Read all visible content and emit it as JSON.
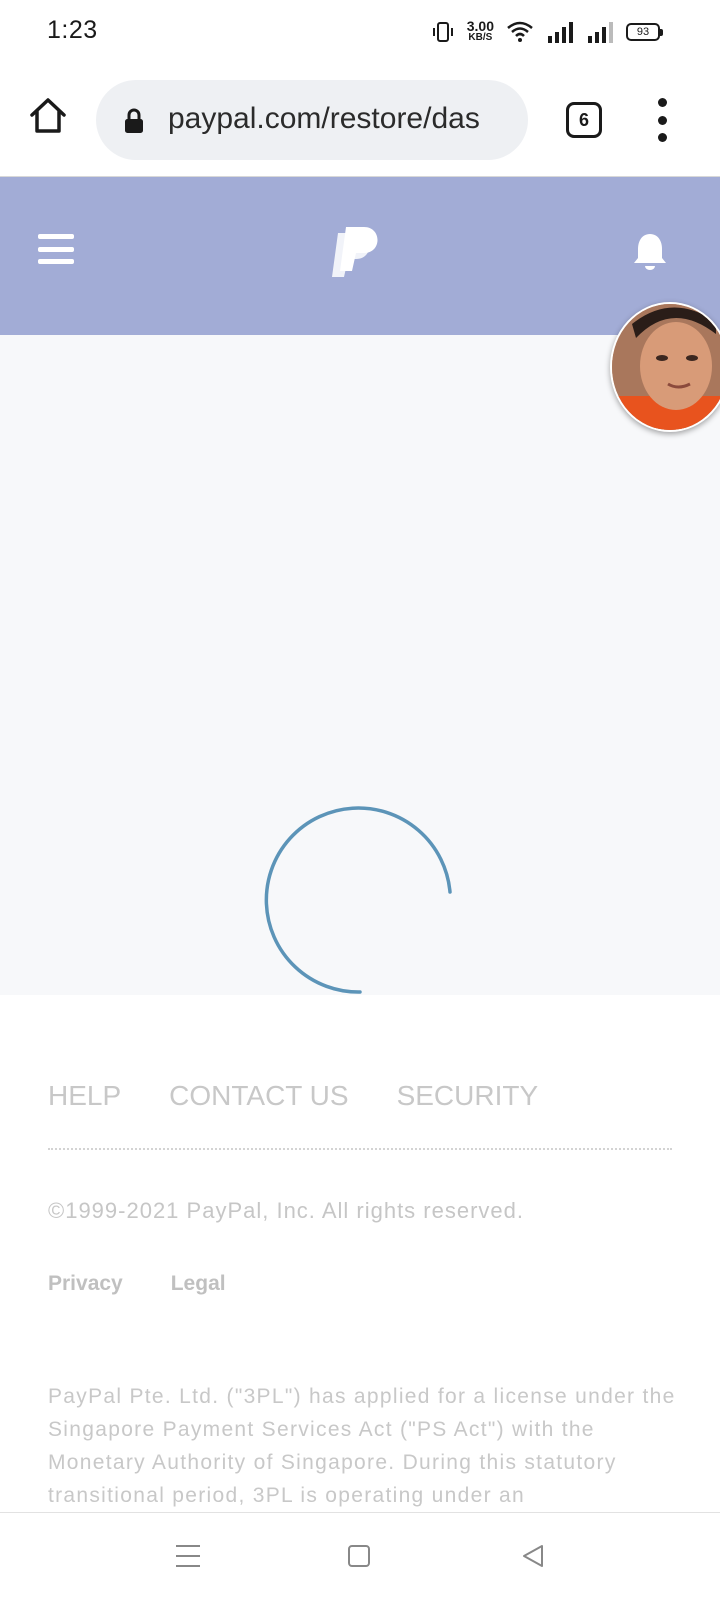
{
  "status_bar": {
    "time": "1:23",
    "net_speed_value": "3.00",
    "net_speed_unit": "KB/S",
    "battery": "93"
  },
  "browser": {
    "url": "paypal.com/restore/das",
    "tab_count": "6"
  },
  "header": {
    "bg_color": "#a2acd6",
    "menu_icon": "hamburger-menu-icon",
    "logo": "paypal-logo",
    "bell_icon": "bell-icon"
  },
  "loading": {
    "spinner_color": "#5c94b8"
  },
  "footer": {
    "links": [
      "HELP",
      "CONTACT US",
      "SECURITY"
    ],
    "copyright": "©1999-2021 PayPal, Inc. All rights reserved.",
    "legal_links": [
      "Privacy",
      "Legal"
    ],
    "license_text": "PayPal Pte. Ltd. (\"3PL\") has applied for a license under the Singapore Payment Services Act (\"PS Act\") with the Monetary Authority of Singapore. During this statutory transitional period, 3PL is operating under an"
  }
}
